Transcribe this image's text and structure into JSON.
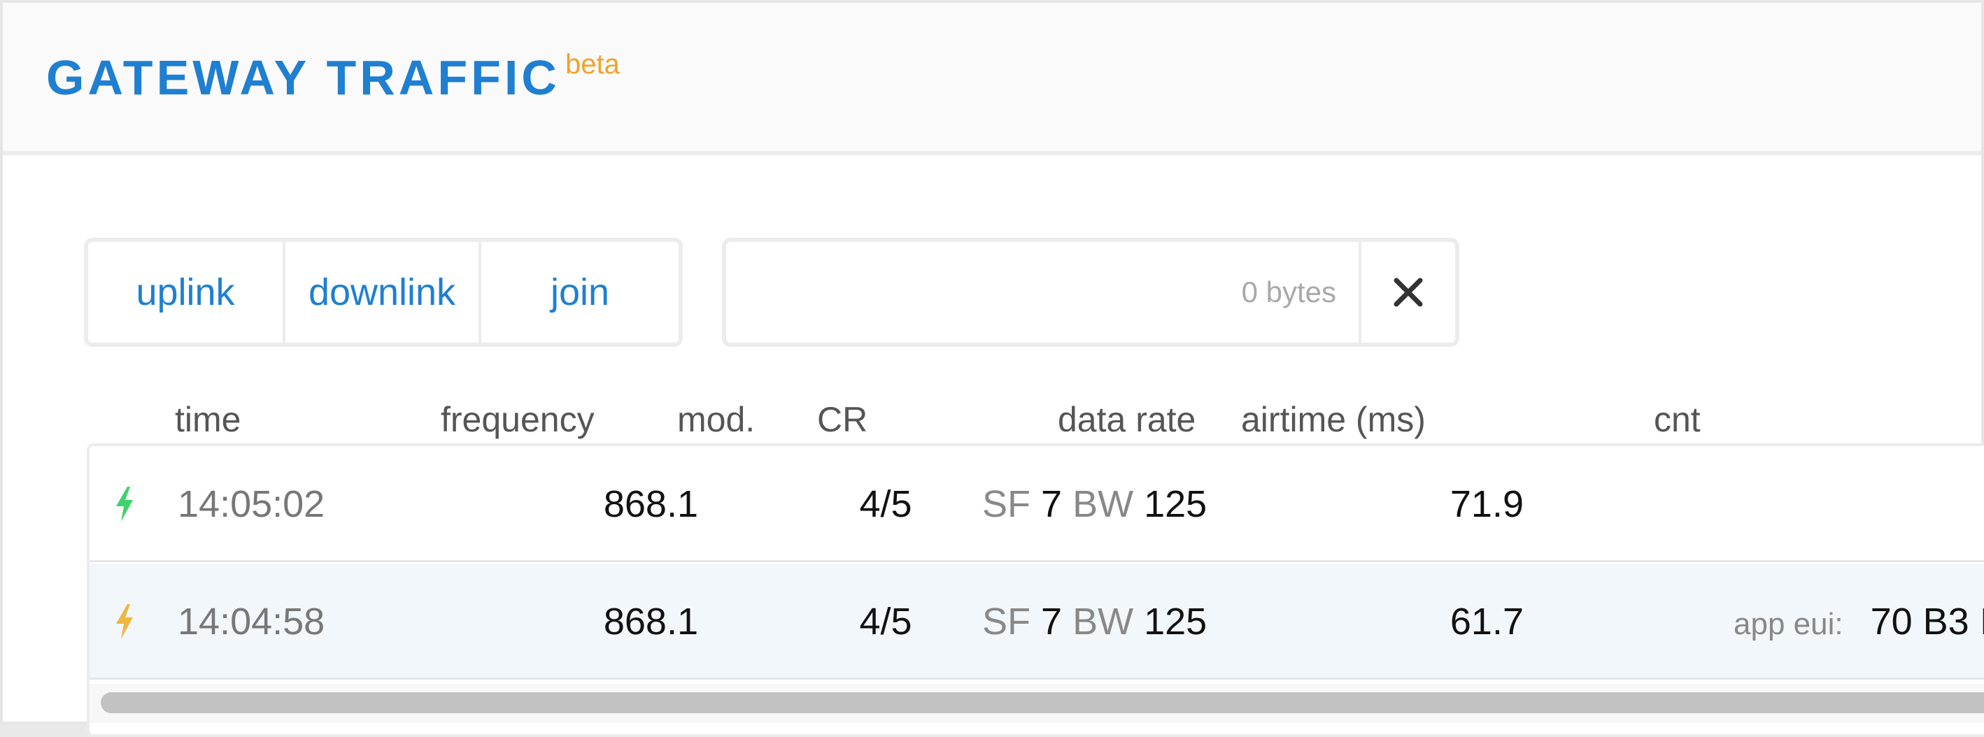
{
  "header": {
    "title": "GATEWAY TRAFFIC",
    "badge": "beta"
  },
  "filters": {
    "buttons": [
      {
        "label": "uplink"
      },
      {
        "label": "downlink"
      },
      {
        "label": "join"
      }
    ],
    "search": {
      "placeholder": "0 bytes",
      "value": ""
    },
    "clear_icon": "close-icon"
  },
  "table": {
    "columns": {
      "time": "time",
      "frequency": "frequency",
      "modulation": "mod.",
      "coding_rate": "CR",
      "data_rate": "data rate",
      "airtime": "airtime (ms)",
      "count": "cnt"
    },
    "rows": [
      {
        "icon": "uplink-bolt-icon",
        "icon_color": "#3fd36b",
        "time": "14:05:02",
        "frequency": "868.1",
        "cr": "4/5",
        "sf_label": "SF",
        "sf": "7",
        "bw_label": "BW",
        "bw": "125",
        "airtime": "71.9"
      },
      {
        "icon": "join-bolt-icon",
        "icon_color": "#f0b640",
        "time": "14:04:58",
        "frequency": "868.1",
        "cr": "4/5",
        "sf_label": "SF",
        "sf": "7",
        "bw_label": "BW",
        "bw": "125",
        "airtime": "61.7",
        "app_eui_label": "app eui:",
        "app_eui": "70 B3 I"
      }
    ]
  },
  "colors": {
    "accent": "#1f7fd1",
    "beta": "#f0a32a",
    "row_highlight": "#f1f7fb"
  }
}
